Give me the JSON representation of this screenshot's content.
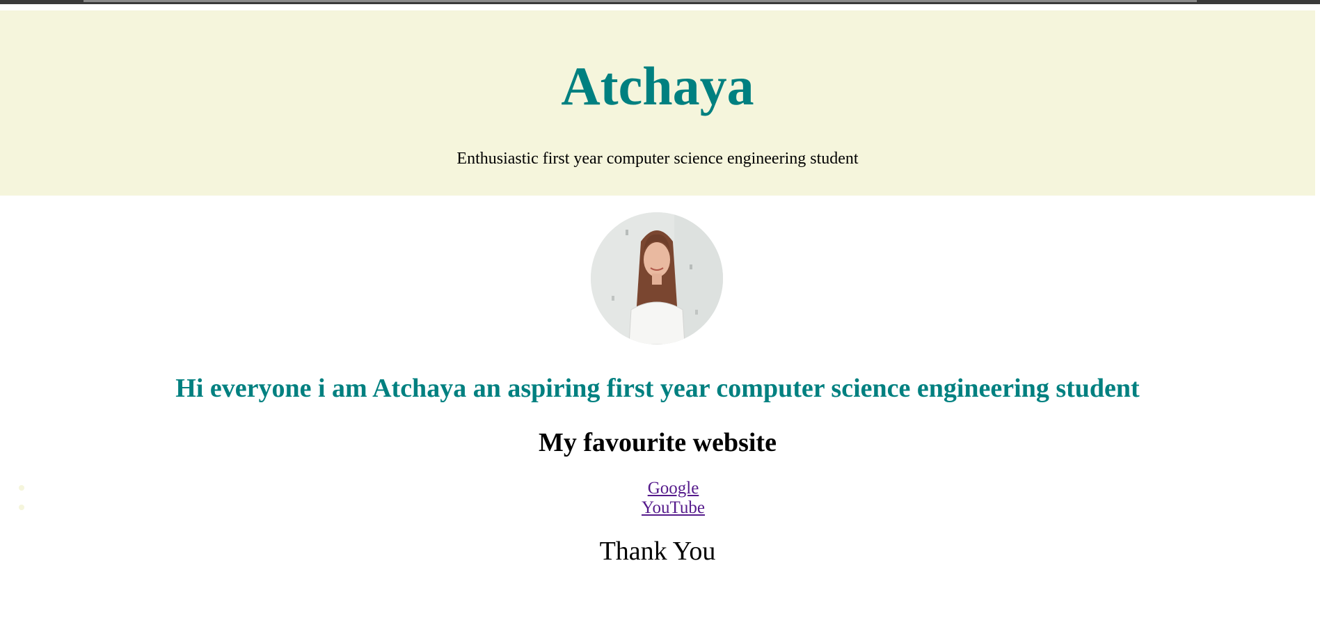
{
  "header": {
    "title": "Atchaya",
    "tagline": "Enthusiastic first year computer science engineering student",
    "background_color": "#f5f5dc",
    "title_color": "#008080"
  },
  "profile": {
    "image_alt": "profile photo"
  },
  "intro": {
    "text": "Hi everyone i am Atchaya an aspiring first year computer science engineering student",
    "color": "#008080"
  },
  "favourites": {
    "heading": "My favourite website",
    "links": [
      {
        "label": "Google"
      },
      {
        "label": "YouTube"
      }
    ],
    "link_color": "#551a8b"
  },
  "footer": {
    "text": "Thank You"
  }
}
